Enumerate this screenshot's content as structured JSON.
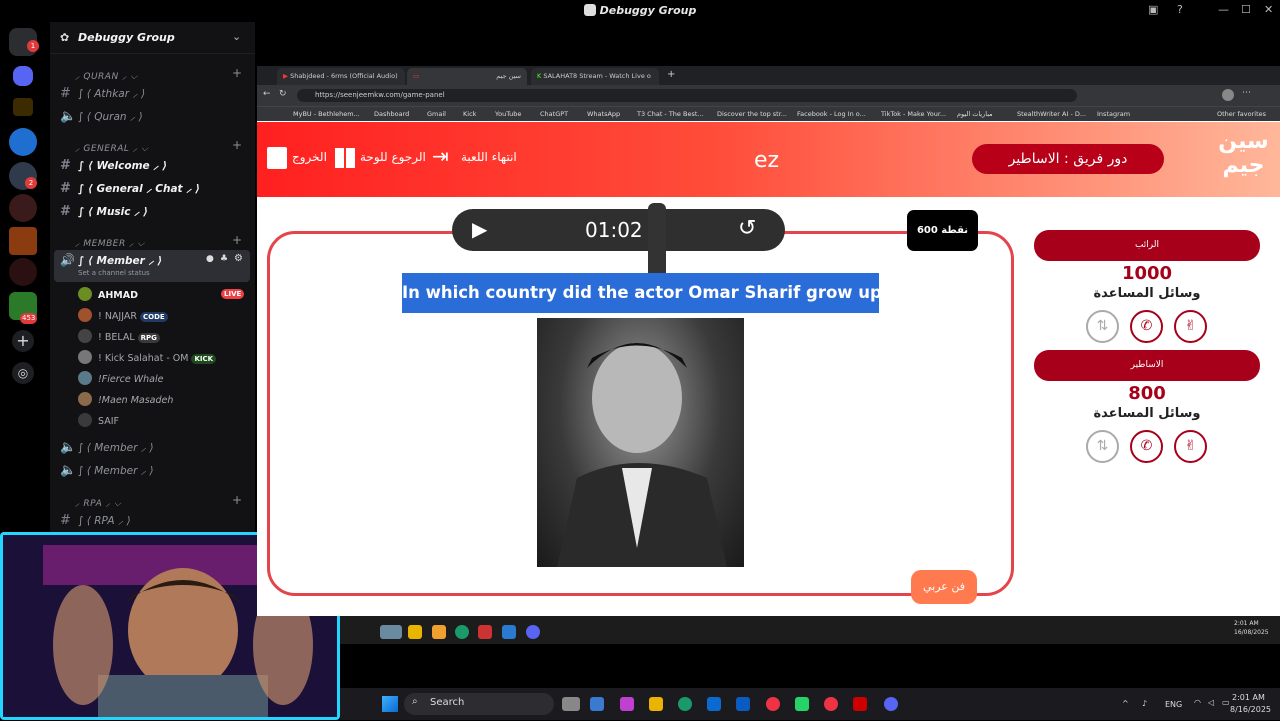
{
  "window": {
    "title": "Debuggy Group"
  },
  "discord": {
    "guild_name": "Debuggy Group",
    "categories": [
      {
        "label": "⸝ QURAN ⸝ ⌵"
      },
      {
        "label": "⸝ GENERAL ⸝ ⌵"
      },
      {
        "label": "⸝ MEMBER ⸝ ⌵"
      },
      {
        "label": "⸝ RPA ⸝ ⌵"
      }
    ],
    "channels": {
      "athkar": "∫ ⟨ Athkar ⸝ ⟩",
      "quran": "∫ ⟨ Quran ⸝ ⟩",
      "welcome": "∫ ⟨ Welcome ⸝ ⟩",
      "general_chat": "∫ ⟨ General ⸝ Chat ⸝ ⟩",
      "music": "∫ ⟨ Music ⸝ ⟩",
      "member_active": "∫ ⟨ Member ⸝ ⟩",
      "member_status": "Set a channel status",
      "member2": "∫ ⟨ Member ⸝ ⟩",
      "member3": "∫ ⟨ Member ⸝ ⟩",
      "rpa": "∫ ⟨ RPA ⸝ ⟩"
    },
    "voice_users": [
      {
        "name": "AHMAD",
        "badge": "LIVE"
      },
      {
        "name": "! NAJJAR",
        "badge": "CODE"
      },
      {
        "name": "! BELAL",
        "badge": "RPG"
      },
      {
        "name": "! Kick Salahat - OM",
        "badge": "KICK"
      },
      {
        "name": "!Fierce Whale",
        "badge": ""
      },
      {
        "name": "!Maen Masadeh",
        "badge": ""
      },
      {
        "name": "SAIF",
        "badge": ""
      }
    ],
    "rail_badges": {
      "notif": "1",
      "unread": "453",
      "count2": "2"
    }
  },
  "browser": {
    "tabs": [
      "Shabjdeed - 6rms (Official Audio)",
      "سين جيم",
      "SALAHAT8 Stream - Watch Live o"
    ],
    "url": "https://seenjeemkw.com/game-panel",
    "bookmarks": [
      "MyBU - Bethlehem...",
      "Dashboard",
      "Gmail",
      "Kick",
      "YouTube",
      "ChatGPT",
      "WhatsApp",
      "T3 Chat - The Best...",
      "Discover the top str...",
      "Facebook - Log In o...",
      "TikTok - Make Your...",
      "مباريات اليوم",
      "StealthWriter AI - D...",
      "Instagram"
    ],
    "other_bookmarks": "Other favorites"
  },
  "game": {
    "exit_label": "الخروج",
    "board_label": "الرجوع للوحة",
    "end_label": "انتهاء اللعبة",
    "current_text": "ez",
    "turn_label": "دور فريق : الاساطير",
    "logo": "سين جيم",
    "timer": "01:02",
    "points": "600 نقطة",
    "question": "In which country did the actor Omar Sharif grow up?",
    "category": "فن عربي",
    "teams": [
      {
        "name": "الرائب",
        "score": "1000",
        "aids_label": "وسائل المساعدة"
      },
      {
        "name": "الاساطير",
        "score": "800",
        "aids_label": "وسائل المساعدة"
      }
    ]
  },
  "taskbar": {
    "search_placeholder": "Search",
    "lang": "ENG",
    "time": "2:01 AM",
    "date": "8/16/2025",
    "inner_time": "2:01 AM",
    "inner_date": "16/08/2025"
  }
}
